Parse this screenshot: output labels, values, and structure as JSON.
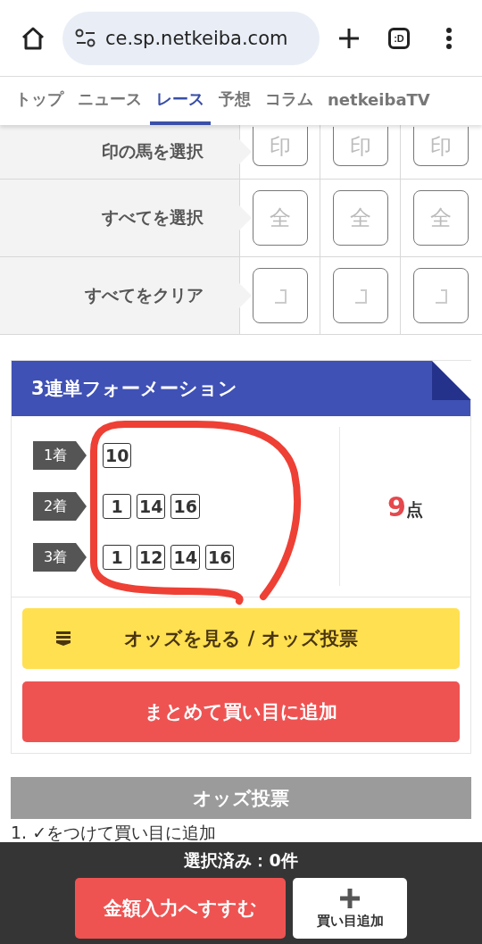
{
  "browser": {
    "url": "ce.sp.netkeiba.com",
    "tab_switcher": ":D"
  },
  "nav_tabs": [
    {
      "label": "トップ",
      "selected": false
    },
    {
      "label": "ニュース",
      "selected": false
    },
    {
      "label": "レース",
      "selected": true
    },
    {
      "label": "予想",
      "selected": false
    },
    {
      "label": "コラム",
      "selected": false
    },
    {
      "label": "netkeibaTV",
      "selected": false
    }
  ],
  "selection_rows": [
    {
      "label": "印の馬を選択",
      "buttons": [
        {
          "kind": "text",
          "label": "印"
        },
        {
          "kind": "text",
          "label": "印"
        },
        {
          "kind": "text",
          "label": "印"
        }
      ]
    },
    {
      "label": "すべてを選択",
      "buttons": [
        {
          "kind": "text",
          "label": "全"
        },
        {
          "kind": "text",
          "label": "全"
        },
        {
          "kind": "text",
          "label": "全"
        }
      ]
    },
    {
      "label": "すべてをクリア",
      "buttons": [
        {
          "kind": "clear"
        },
        {
          "kind": "clear"
        },
        {
          "kind": "clear"
        }
      ]
    }
  ],
  "formation": {
    "title": "3連単フォーメーション",
    "places": [
      {
        "label": "1着",
        "numbers": [
          "10"
        ]
      },
      {
        "label": "2着",
        "numbers": [
          "1",
          "14",
          "16"
        ]
      },
      {
        "label": "3着",
        "numbers": [
          "1",
          "12",
          "14",
          "16"
        ]
      }
    ],
    "points_value": "9",
    "points_unit": "点",
    "odds_button": "オッズを見る / オッズ投票",
    "add_all_button": "まとめて買い目に追加"
  },
  "odds_vote": {
    "title": "オッズ投票",
    "steps": [
      "1. ✓をつけて買い目に追加"
    ]
  },
  "bottom_bar": {
    "selected_count": "選択済み：0件",
    "next_button": "金額入力へすすむ",
    "add_button": "買い目追加"
  }
}
